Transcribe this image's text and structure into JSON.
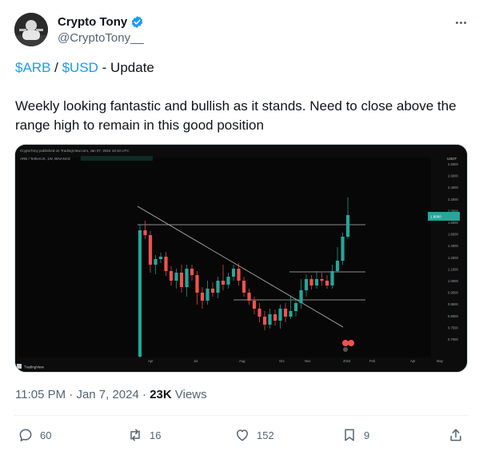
{
  "author": {
    "display_name": "Crypto Tony",
    "handle": "@CryptoTony__"
  },
  "tweet": {
    "line1": {
      "cashtag1": "$ARB",
      "sep": " / ",
      "cashtag2": "$USD",
      "rest": " - Update"
    },
    "body": "Weekly looking fantastic and bullish as it stands. Need to close above the range high to remain in this good position"
  },
  "chart_image": {
    "watermark": "CryptoTony published on TradingView.com, Jan 07, 2024 18:10 UTC",
    "symbol_line": "ARB / TetherUS, 1W, BINANCE",
    "price_tag": "1.9890",
    "currency": "USDT",
    "brand": "TradingView",
    "x_ticks": [
      "Apr",
      "Jul",
      "Aug",
      "Oct",
      "Nov",
      "2024",
      "Feb",
      "Apr",
      "May"
    ],
    "y_ticks": [
      "2.8000",
      "2.6000",
      "2.4000",
      "2.2000",
      "2.0000",
      "1.8000",
      "1.6000",
      "1.4000",
      "1.2000",
      "1.1000",
      "1.0000",
      "0.9000",
      "0.8500",
      "0.8000",
      "0.7500",
      "0.7000"
    ],
    "colors": {
      "up": "#26a69a",
      "down": "#ef5350",
      "background": "#0c0c0c"
    }
  },
  "meta": {
    "time": "11:05 PM",
    "dot": " · ",
    "date": "Jan 7, 2024",
    "views_count": "23K",
    "views_label": " Views"
  },
  "actions": {
    "replies": "60",
    "reposts": "16",
    "likes": "152",
    "bookmarks": "9"
  }
}
